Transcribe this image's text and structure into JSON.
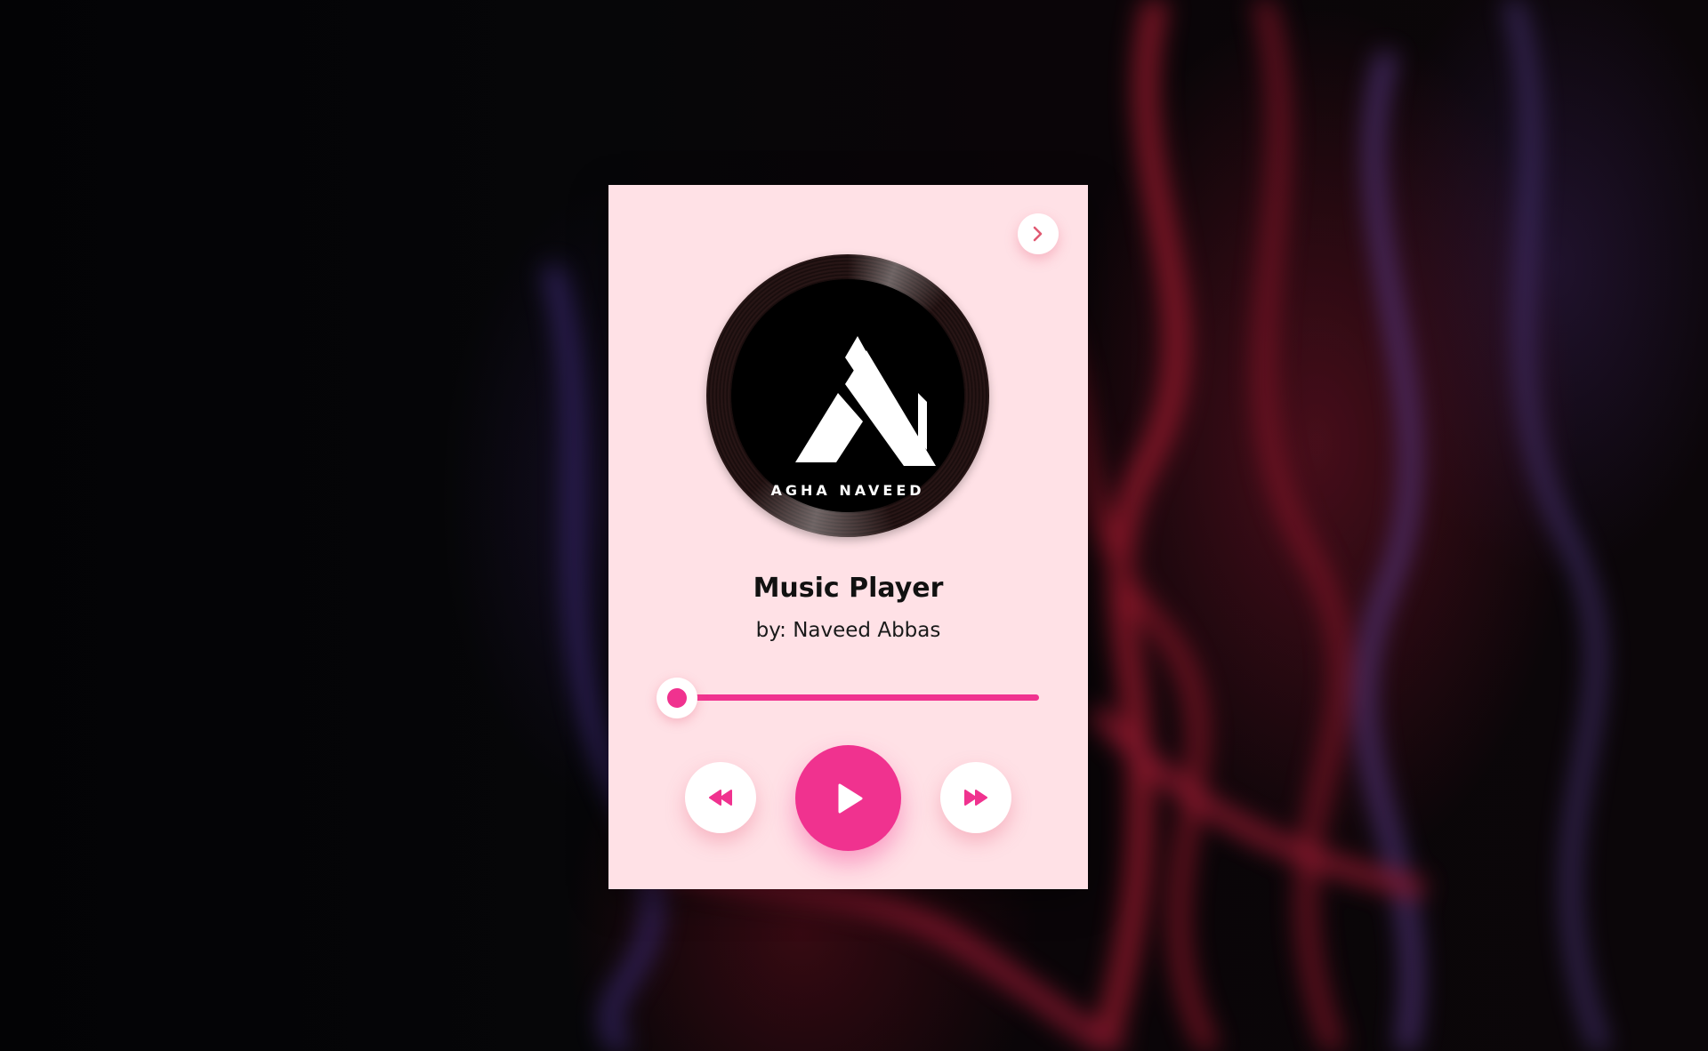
{
  "background": {
    "description_colors": {
      "base": "#050507",
      "accent_red": "#7a1428",
      "accent_purple": "#462a6e"
    }
  },
  "player": {
    "card_color": "#ffe1e6",
    "accent_color": "#f0328f",
    "album_art": {
      "logo_text": "AGHA NAVEED",
      "icon": "vinyl-record-icon"
    },
    "track_title": "Music Player",
    "artist_line": "by: Naveed Abbas",
    "progress_fraction": 0.05,
    "controls": {
      "next_track_icon": "chevron-right-icon",
      "rewind_icon": "rewind-icon",
      "play_icon": "play-icon",
      "forward_icon": "fast-forward-icon"
    }
  }
}
